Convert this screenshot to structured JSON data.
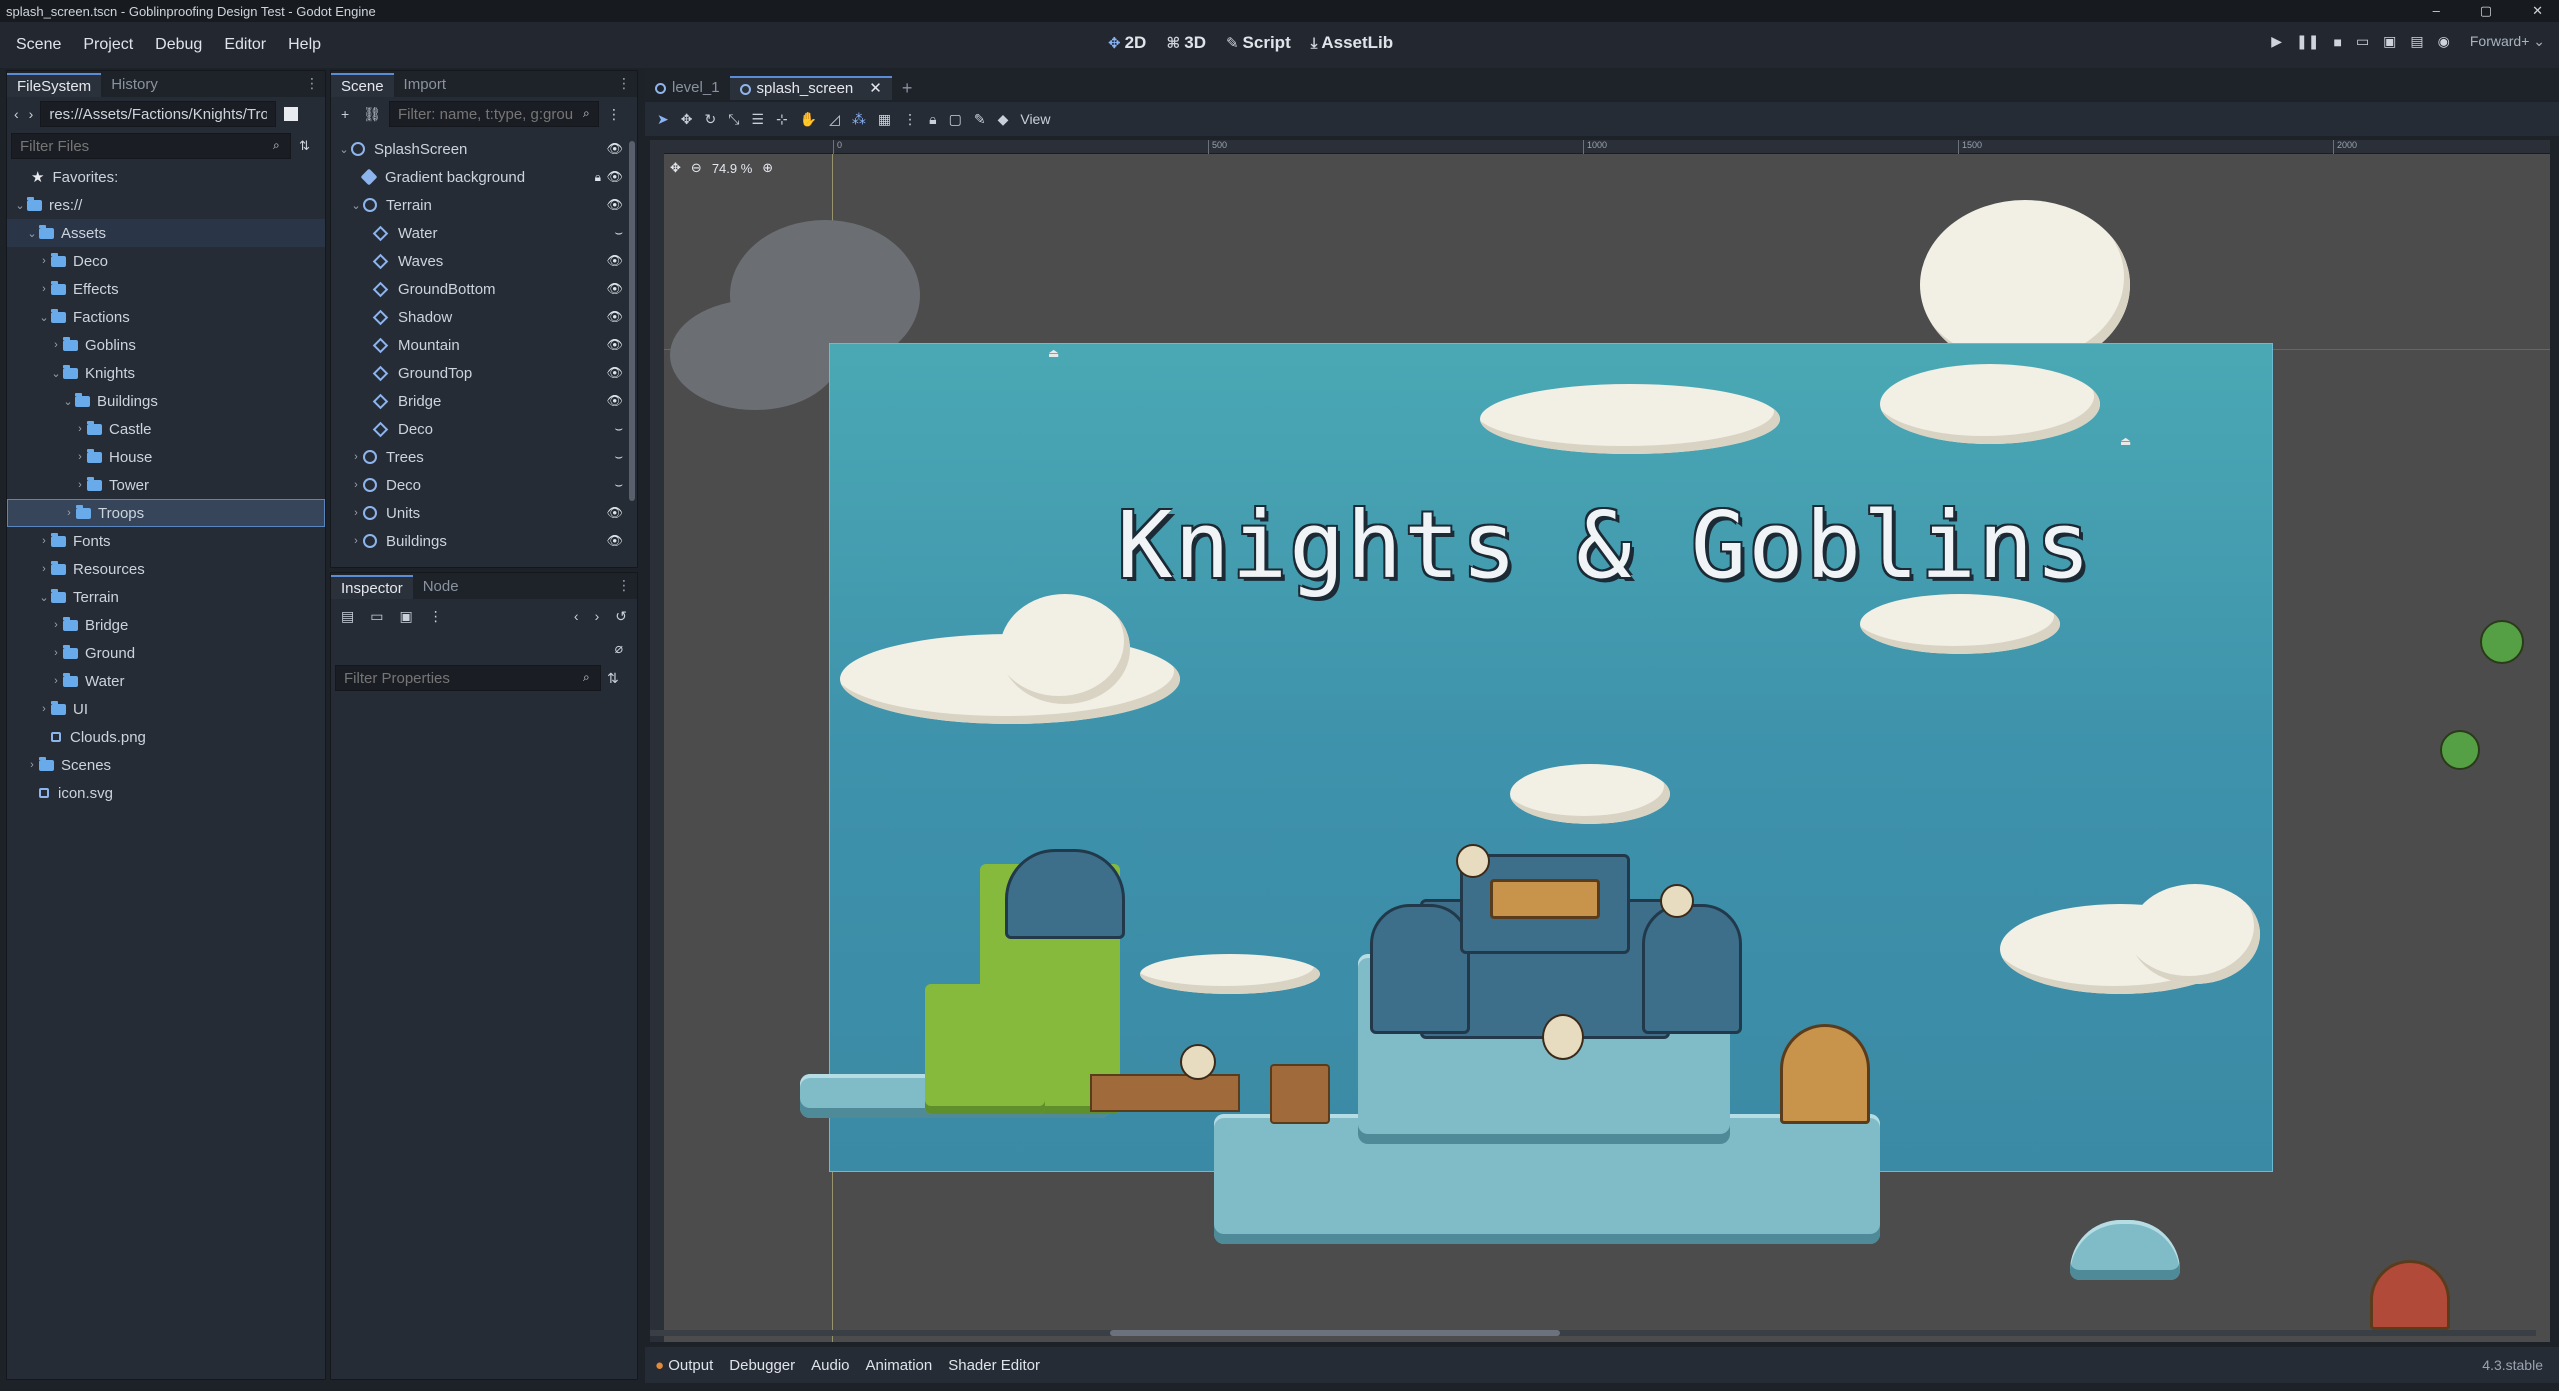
{
  "window": {
    "title": "splash_screen.tscn - Goblinproofing Design Test - Godot Engine",
    "controls": [
      "–",
      "▢",
      "✕"
    ]
  },
  "menubar": {
    "items": [
      "Scene",
      "Project",
      "Debug",
      "Editor",
      "Help"
    ]
  },
  "main_screens": [
    {
      "icon": "✥",
      "label": "2D"
    },
    {
      "icon": "⌘",
      "label": "3D"
    },
    {
      "icon": "✎",
      "label": "Script"
    },
    {
      "icon": "⤓",
      "label": "AssetLib"
    }
  ],
  "run_controls": {
    "renderer": "Forward+ ⌄"
  },
  "filesystem": {
    "tabs": [
      "FileSystem",
      "History"
    ],
    "path": "res://Assets/Factions/Knights/Troo",
    "filter_placeholder": "Filter Files",
    "favorites": "Favorites:",
    "root": "res://",
    "items": [
      {
        "label": "Assets",
        "indent": 1,
        "arrow": "⌄",
        "folder": true,
        "hl": true
      },
      {
        "label": "Deco",
        "indent": 2,
        "arrow": "›",
        "folder": true
      },
      {
        "label": "Effects",
        "indent": 2,
        "arrow": "›",
        "folder": true
      },
      {
        "label": "Factions",
        "indent": 2,
        "arrow": "⌄",
        "folder": true
      },
      {
        "label": "Goblins",
        "indent": 3,
        "arrow": "›",
        "folder": true
      },
      {
        "label": "Knights",
        "indent": 3,
        "arrow": "⌄",
        "folder": true
      },
      {
        "label": "Buildings",
        "indent": 4,
        "arrow": "⌄",
        "folder": true
      },
      {
        "label": "Castle",
        "indent": 5,
        "arrow": "›",
        "folder": true
      },
      {
        "label": "House",
        "indent": 5,
        "arrow": "›",
        "folder": true
      },
      {
        "label": "Tower",
        "indent": 5,
        "arrow": "›",
        "folder": true
      },
      {
        "label": "Troops",
        "indent": 4,
        "arrow": "›",
        "folder": true,
        "sel": true
      },
      {
        "label": "Fonts",
        "indent": 2,
        "arrow": "›",
        "folder": true
      },
      {
        "label": "Resources",
        "indent": 2,
        "arrow": "›",
        "folder": true
      },
      {
        "label": "Terrain",
        "indent": 2,
        "arrow": "⌄",
        "folder": true
      },
      {
        "label": "Bridge",
        "indent": 3,
        "arrow": "›",
        "folder": true
      },
      {
        "label": "Ground",
        "indent": 3,
        "arrow": "›",
        "folder": true
      },
      {
        "label": "Water",
        "indent": 3,
        "arrow": "›",
        "folder": true
      },
      {
        "label": "UI",
        "indent": 2,
        "arrow": "›",
        "folder": true
      },
      {
        "label": "Clouds.png",
        "indent": 2,
        "arrow": "",
        "folder": false
      },
      {
        "label": "Scenes",
        "indent": 1,
        "arrow": "›",
        "folder": true
      },
      {
        "label": "icon.svg",
        "indent": 1,
        "arrow": "",
        "folder": false
      }
    ]
  },
  "scene_dock": {
    "tabs": [
      "Scene",
      "Import"
    ],
    "filter_placeholder": "Filter: name, t:type, g:grou",
    "nodes": [
      {
        "label": "SplashScreen",
        "indent": 0,
        "arrow": "⌄",
        "type": "node2d",
        "vis": "eye"
      },
      {
        "label": "Gradient background",
        "indent": 1,
        "arrow": "",
        "type": "sprite",
        "vis": "eye",
        "lock": true
      },
      {
        "label": "Terrain",
        "indent": 1,
        "arrow": "⌄",
        "type": "node2d",
        "vis": "eye"
      },
      {
        "label": "Water",
        "indent": 2,
        "arrow": "",
        "type": "tilemap",
        "vis": "hidden"
      },
      {
        "label": "Waves",
        "indent": 2,
        "arrow": "",
        "type": "tilemap",
        "vis": "eye"
      },
      {
        "label": "GroundBottom",
        "indent": 2,
        "arrow": "",
        "type": "tilemap",
        "vis": "eye"
      },
      {
        "label": "Shadow",
        "indent": 2,
        "arrow": "",
        "type": "tilemap",
        "vis": "eye"
      },
      {
        "label": "Mountain",
        "indent": 2,
        "arrow": "",
        "type": "tilemap",
        "vis": "eye"
      },
      {
        "label": "GroundTop",
        "indent": 2,
        "arrow": "",
        "type": "tilemap",
        "vis": "eye"
      },
      {
        "label": "Bridge",
        "indent": 2,
        "arrow": "",
        "type": "tilemap",
        "vis": "eye"
      },
      {
        "label": "Deco",
        "indent": 2,
        "arrow": "",
        "type": "tilemap",
        "vis": "hidden"
      },
      {
        "label": "Trees",
        "indent": 1,
        "arrow": "›",
        "type": "node2d",
        "vis": "hidden"
      },
      {
        "label": "Deco",
        "indent": 1,
        "arrow": "›",
        "type": "node2d",
        "vis": "hidden"
      },
      {
        "label": "Units",
        "indent": 1,
        "arrow": "›",
        "type": "node2d",
        "vis": "eye"
      },
      {
        "label": "Buildings",
        "indent": 1,
        "arrow": "›",
        "type": "node2d",
        "vis": "eye"
      }
    ]
  },
  "inspector": {
    "tabs": [
      "Inspector",
      "Node"
    ],
    "filter_placeholder": "Filter Properties"
  },
  "editor_tabs": [
    {
      "label": "level_1",
      "active": false
    },
    {
      "label": "splash_screen",
      "active": true
    }
  ],
  "viewport": {
    "zoom": "74.9 %",
    "view_menu": "View",
    "ruler_labels": [
      "0",
      "500",
      "1000",
      "1500",
      "2000"
    ],
    "game_title": "Knights & Goblins"
  },
  "bottom_panel": {
    "tabs": [
      "Output",
      "Debugger",
      "Audio",
      "Animation",
      "Shader Editor"
    ],
    "version": "4.3.stable"
  }
}
